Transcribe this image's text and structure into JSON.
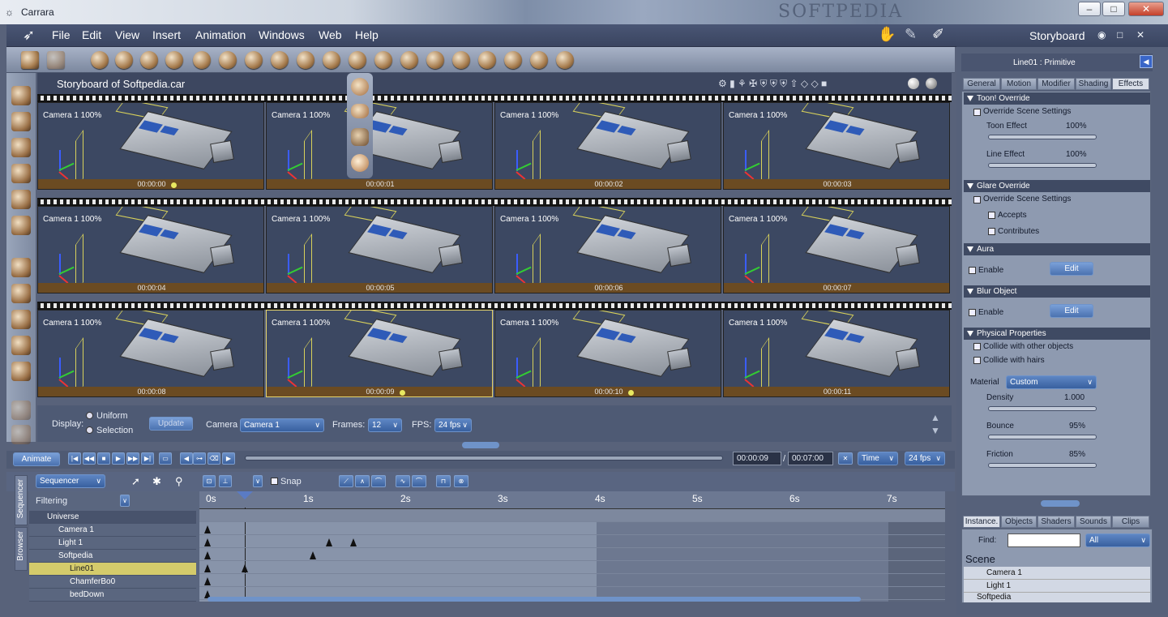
{
  "window": {
    "title": "Carrara",
    "minimize": "–",
    "maximize": "□",
    "close": "✕"
  },
  "menu": [
    "File",
    "Edit",
    "View",
    "Insert",
    "Animation",
    "Windows",
    "Web",
    "Help"
  ],
  "room": {
    "label": "Storyboard",
    "buttons": [
      "◉",
      "□",
      "✕"
    ]
  },
  "storyboard": {
    "title": "Storyboard of Softpedia.car",
    "frames": [
      {
        "cam": "Camera 1 100%",
        "time": "00:00:00",
        "dot": true
      },
      {
        "cam": "Camera 1 100%",
        "time": "00:00:01",
        "dot": false
      },
      {
        "cam": "Camera 1 100%",
        "time": "00:00:02",
        "dot": false
      },
      {
        "cam": "Camera 1 100%",
        "time": "00:00:03",
        "dot": false
      },
      {
        "cam": "Camera 1 100%",
        "time": "00:00:04",
        "dot": false
      },
      {
        "cam": "Camera 1 100%",
        "time": "00:00:05",
        "dot": false
      },
      {
        "cam": "Camera 1 100%",
        "time": "00:00:06",
        "dot": false
      },
      {
        "cam": "Camera 1 100%",
        "time": "00:00:07",
        "dot": false
      },
      {
        "cam": "Camera 1 100%",
        "time": "00:00:08",
        "dot": false
      },
      {
        "cam": "Camera 1 100%",
        "time": "00:00:09",
        "dot": true
      },
      {
        "cam": "Camera 1 100%",
        "time": "00:00:10",
        "dot": true
      },
      {
        "cam": "Camera 1 100%",
        "time": "00:00:11",
        "dot": false
      }
    ],
    "display_label": "Display:",
    "uniform": "Uniform",
    "selection": "Selection",
    "update": "Update",
    "camera_label": "Camera",
    "camera_value": "Camera 1",
    "frames_label": "Frames:",
    "frames_value": "12",
    "fps_label": "FPS:",
    "fps_value": "24 fps"
  },
  "anim": {
    "animate": "Animate",
    "current_time": "00:00:09",
    "sep": "/",
    "total_time": "00:07:00",
    "time_mode": "Time",
    "fps": "24 fps"
  },
  "sequencer": {
    "mode": "Sequencer",
    "filtering": "Filtering",
    "snap": "Snap",
    "side_tabs": [
      "Sequencer",
      "Browser"
    ],
    "ticks": [
      "0s",
      "1s",
      "2s",
      "3s",
      "4s",
      "5s",
      "6s",
      "7s"
    ],
    "rows": [
      {
        "label": "Universe",
        "sel": false
      },
      {
        "label": "Camera 1",
        "sel": false
      },
      {
        "label": "Light 1",
        "sel": false
      },
      {
        "label": "Softpedia",
        "sel": false
      },
      {
        "label": "Line01",
        "sel": true
      },
      {
        "label": "ChamferBo0",
        "sel": false
      },
      {
        "label": "bedDown",
        "sel": false
      }
    ]
  },
  "properties": {
    "header": "Line01 : Primitive",
    "tabs": [
      "General",
      "Motion",
      "Modifier",
      "Shading",
      "Effects"
    ],
    "active_tab": "Effects",
    "toon": {
      "title": "Toon! Override",
      "override": "Override Scene Settings",
      "toon_effect": "Toon Effect",
      "toon_val": "100%",
      "line_effect": "Line Effect",
      "line_val": "100%"
    },
    "glare": {
      "title": "Glare Override",
      "override": "Override Scene Settings",
      "accepts": "Accepts",
      "contributes": "Contributes"
    },
    "aura": {
      "title": "Aura",
      "enable": "Enable",
      "edit": "Edit"
    },
    "blur": {
      "title": "Blur Object",
      "enable": "Enable",
      "edit": "Edit"
    },
    "physical": {
      "title": "Physical Properties",
      "collide_objects": "Collide with other objects",
      "collide_hairs": "Collide with hairs",
      "material_label": "Material",
      "material_value": "Custom",
      "density": "Density",
      "density_val": "1.000",
      "bounce": "Bounce",
      "bounce_val": "95%",
      "friction": "Friction",
      "friction_val": "85%"
    }
  },
  "browser": {
    "tabs": [
      "Instance.",
      "Objects",
      "Shaders",
      "Sounds",
      "Clips"
    ],
    "find_label": "Find:",
    "filter": "All",
    "scene_title": "Scene",
    "items": [
      "Camera 1",
      "Light 1",
      "Softpedia"
    ]
  },
  "watermark": "SOFTPEDIA"
}
